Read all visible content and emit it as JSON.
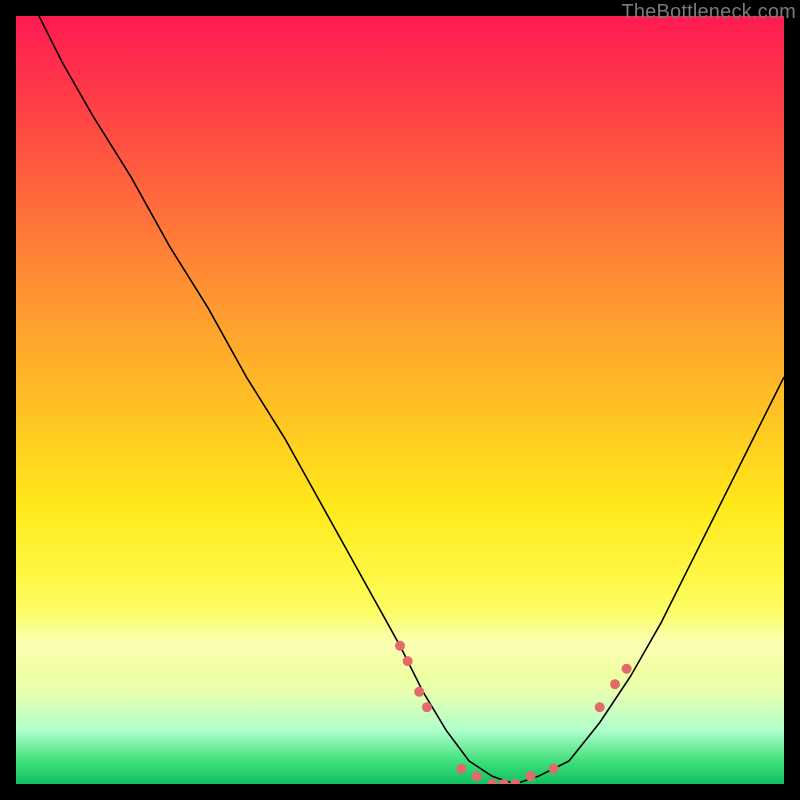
{
  "attribution": "TheBottleneck.com",
  "chart_data": {
    "type": "line",
    "title": "",
    "xlabel": "",
    "ylabel": "",
    "xlim": [
      0,
      100
    ],
    "ylim": [
      0,
      100
    ],
    "grid": false,
    "legend": false,
    "background": {
      "kind": "vertical-gradient",
      "stops": [
        {
          "pos": 0,
          "color": "#ff1a52"
        },
        {
          "pos": 24,
          "color": "#ff6a3c"
        },
        {
          "pos": 52,
          "color": "#ffc423"
        },
        {
          "pos": 74,
          "color": "#fff94a"
        },
        {
          "pos": 93,
          "color": "#b0ffcc"
        },
        {
          "pos": 100,
          "color": "#10c060"
        }
      ]
    },
    "series": [
      {
        "name": "bottleneck-curve",
        "color": "#000000",
        "x": [
          3,
          6,
          10,
          15,
          20,
          25,
          30,
          35,
          40,
          45,
          50,
          53,
          56,
          59,
          62,
          65,
          68,
          72,
          76,
          80,
          84,
          88,
          92,
          96,
          100
        ],
        "y": [
          100,
          94,
          87,
          79,
          70,
          62,
          53,
          45,
          36,
          27,
          18,
          12,
          7,
          3,
          1,
          0,
          1,
          3,
          8,
          14,
          21,
          29,
          37,
          45,
          53
        ]
      }
    ],
    "markers": [
      {
        "x": 50,
        "y": 18
      },
      {
        "x": 51,
        "y": 16
      },
      {
        "x": 52.5,
        "y": 12
      },
      {
        "x": 53.5,
        "y": 10
      },
      {
        "x": 58,
        "y": 2
      },
      {
        "x": 60,
        "y": 1
      },
      {
        "x": 62,
        "y": 0
      },
      {
        "x": 63.5,
        "y": 0
      },
      {
        "x": 65,
        "y": 0
      },
      {
        "x": 67,
        "y": 1
      },
      {
        "x": 70,
        "y": 2
      },
      {
        "x": 76,
        "y": 10
      },
      {
        "x": 78,
        "y": 13
      },
      {
        "x": 79.5,
        "y": 15
      }
    ],
    "marker_style": {
      "color": "#e36a6a",
      "radius_px": 5
    }
  }
}
